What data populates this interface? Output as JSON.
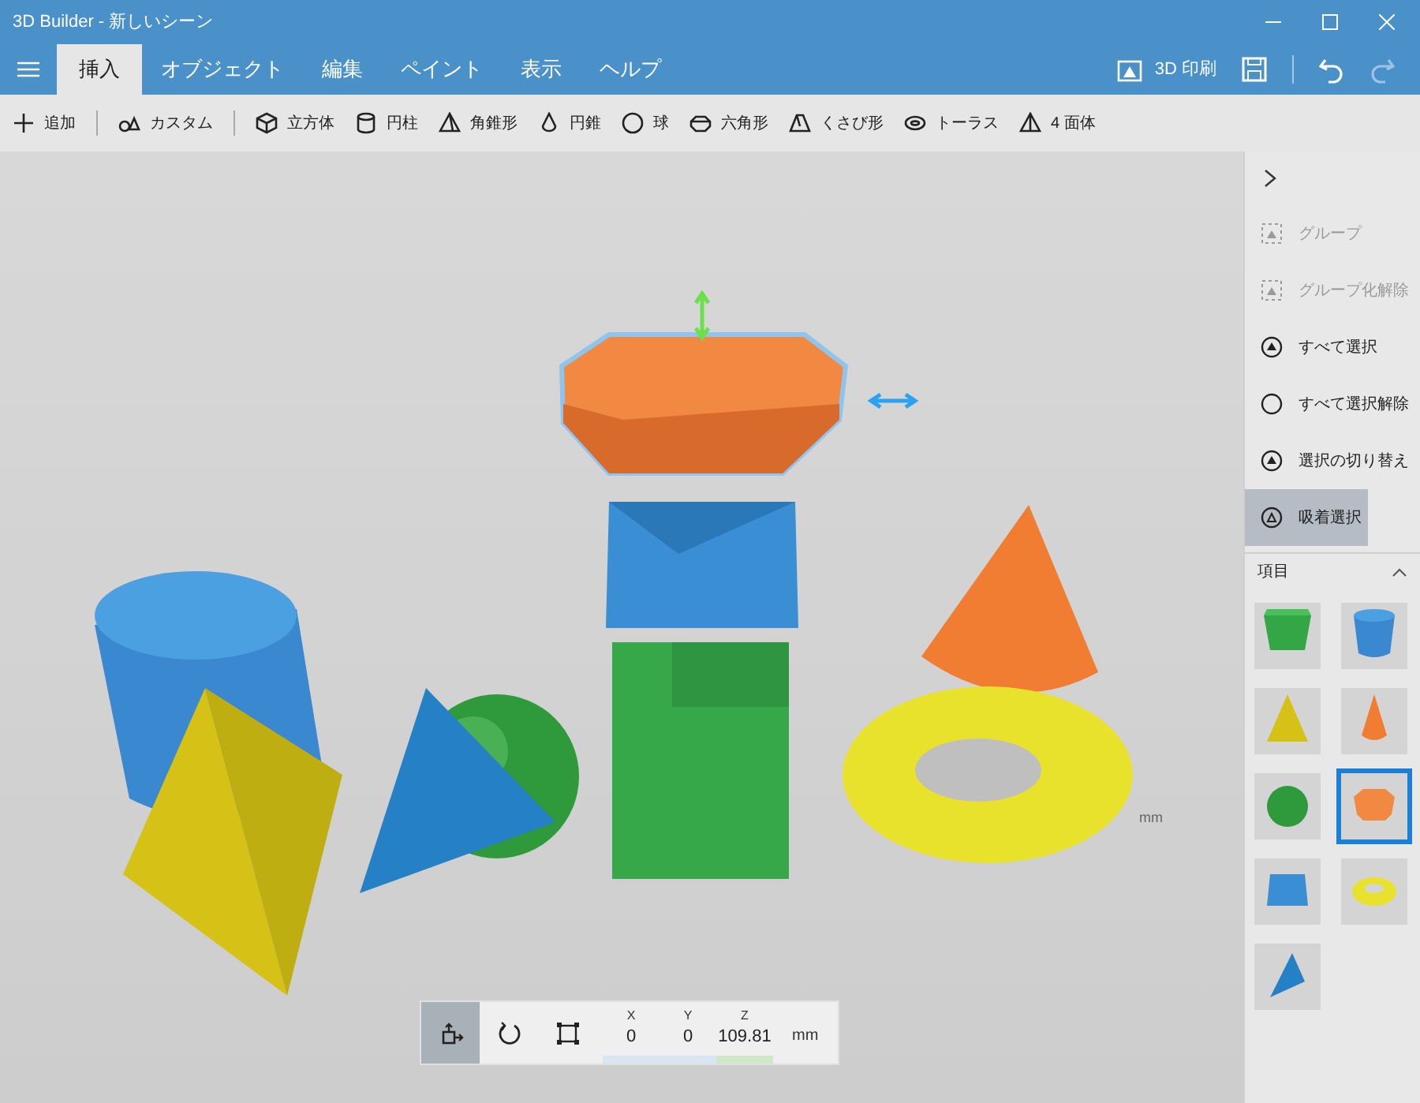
{
  "window": {
    "title": "3D Builder - 新しいシーン"
  },
  "tabs": [
    {
      "label": "挿入",
      "selected": true
    },
    {
      "label": "オブジェクト",
      "selected": false
    },
    {
      "label": "編集",
      "selected": false
    },
    {
      "label": "ペイント",
      "selected": false
    },
    {
      "label": "表示",
      "selected": false
    },
    {
      "label": "ヘルプ",
      "selected": false
    }
  ],
  "print_button": {
    "label": "3D 印刷"
  },
  "toolbar": [
    {
      "kind": "add",
      "label": "追加"
    },
    {
      "kind": "custom",
      "label": "カスタム"
    },
    {
      "kind": "cube",
      "label": "立方体"
    },
    {
      "kind": "cylinder",
      "label": "円柱"
    },
    {
      "kind": "pyramid",
      "label": "角錐形"
    },
    {
      "kind": "cone",
      "label": "円錐"
    },
    {
      "kind": "sphere",
      "label": "球"
    },
    {
      "kind": "hexagon",
      "label": "六角形"
    },
    {
      "kind": "wedge",
      "label": "くさび形"
    },
    {
      "kind": "torus",
      "label": "トーラス"
    },
    {
      "kind": "tetrahedron",
      "label": "4 面体"
    }
  ],
  "side_actions": [
    {
      "kind": "group",
      "label": "グループ",
      "disabled": true,
      "selected": false
    },
    {
      "kind": "group",
      "label": "グループ化解除",
      "disabled": true,
      "selected": false
    },
    {
      "kind": "select",
      "label": "すべて選択",
      "disabled": false,
      "selected": false
    },
    {
      "kind": "circle",
      "label": "すべて選択解除",
      "disabled": false,
      "selected": false
    },
    {
      "kind": "select",
      "label": "選択の切り替え",
      "disabled": false,
      "selected": false
    },
    {
      "kind": "snap",
      "label": "吸着選択",
      "disabled": false,
      "selected": true
    }
  ],
  "items_panel": {
    "title": "項目",
    "expanded": true,
    "items": [
      {
        "kind": "cube",
        "selected": false
      },
      {
        "kind": "cylinder",
        "selected": false
      },
      {
        "kind": "pyramid",
        "selected": false
      },
      {
        "kind": "cone",
        "selected": false
      },
      {
        "kind": "sphere",
        "selected": false
      },
      {
        "kind": "hexagon",
        "selected": true
      },
      {
        "kind": "wedge",
        "selected": false
      },
      {
        "kind": "torus",
        "selected": false
      },
      {
        "kind": "tetrahedron",
        "selected": false
      }
    ]
  },
  "viewport": {
    "unit_label": "mm"
  },
  "transform_bar": {
    "modes": [
      {
        "kind": "move",
        "selected": true
      },
      {
        "kind": "rotate",
        "selected": false
      },
      {
        "kind": "scale",
        "selected": false
      }
    ],
    "coords": [
      {
        "axis": "X",
        "value": "0"
      },
      {
        "axis": "Y",
        "value": "0"
      },
      {
        "axis": "Z",
        "value": "109.81"
      }
    ],
    "unit": "mm"
  }
}
